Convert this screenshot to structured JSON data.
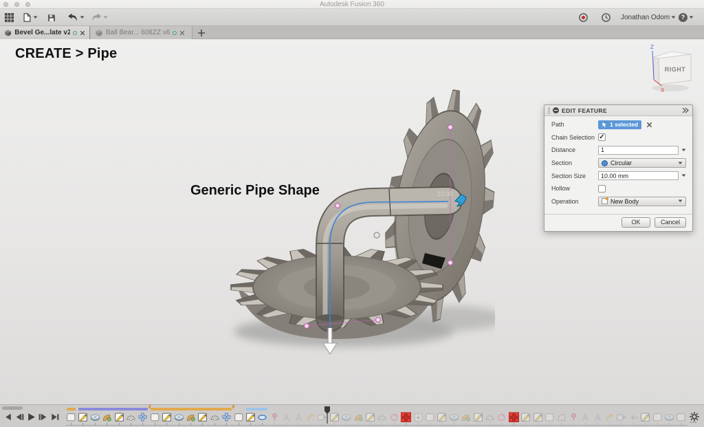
{
  "window": {
    "title": "Autodesk Fusion 360"
  },
  "toolbar": {
    "user_name": "Jonathan Odom",
    "help_glyph": "?"
  },
  "tabs": {
    "items": [
      {
        "label": "Bevel Ge...late v2*"
      },
      {
        "label": "Ball Bear... 608ZZ v6"
      }
    ]
  },
  "canvas": {
    "command_hint": "CREATE > Pipe",
    "annotation": "Generic Pipe Shape",
    "dimension_label": "10.00",
    "viewcube": {
      "face": "RIGHT",
      "axis_z": "Z",
      "axis_x": "X"
    }
  },
  "dialog": {
    "title": "EDIT FEATURE",
    "rows": [
      {
        "label": "Path",
        "value": "1 selected"
      },
      {
        "label": "Chain Selection",
        "checked": true
      },
      {
        "label": "Distance",
        "value": "1"
      },
      {
        "label": "Section",
        "value": "Circular"
      },
      {
        "label": "Section Size",
        "value": "10.00 mm"
      },
      {
        "label": "Hollow",
        "checked": false
      },
      {
        "label": "Operation",
        "value": "New Body"
      }
    ],
    "ok_label": "OK",
    "cancel_label": "Cancel"
  },
  "timeline": {
    "playhead_index": 22,
    "more_indicator": "...",
    "hatch_glyph": "///",
    "groups": [
      {
        "color": "#e3a94e",
        "start": 0,
        "count": 1,
        "hatch": false
      },
      {
        "color": "#8a8ada",
        "start": 1,
        "count": 6,
        "hatch": true
      },
      {
        "color": "#e3a94e",
        "start": 7,
        "count": 7,
        "hatch": true
      },
      {
        "color": "#9cc4ea",
        "start": 15,
        "count": 2,
        "hatch": false
      }
    ],
    "items": [
      {
        "type": "box",
        "state": "normal"
      },
      {
        "type": "sketch",
        "state": "normal"
      },
      {
        "type": "revolve",
        "state": "normal"
      },
      {
        "type": "sweep",
        "state": "normal"
      },
      {
        "type": "sketch",
        "state": "normal"
      },
      {
        "type": "dome",
        "state": "normal"
      },
      {
        "type": "pattern",
        "state": "normal"
      },
      {
        "type": "box",
        "state": "normal"
      },
      {
        "type": "sketch",
        "state": "normal"
      },
      {
        "type": "revolve",
        "state": "normal"
      },
      {
        "type": "sweep",
        "state": "normal"
      },
      {
        "type": "sketch",
        "state": "normal"
      },
      {
        "type": "dome",
        "state": "normal"
      },
      {
        "type": "pattern",
        "state": "normal"
      },
      {
        "type": "box",
        "state": "normal"
      },
      {
        "type": "sketch",
        "state": "normal"
      },
      {
        "type": "link",
        "state": "normal"
      },
      {
        "type": "pin",
        "state": "faded"
      },
      {
        "type": "jointA",
        "state": "faded"
      },
      {
        "type": "jointA",
        "state": "faded"
      },
      {
        "type": "thread",
        "state": "faded"
      },
      {
        "type": "export",
        "state": "faded"
      },
      {
        "type": "sketch",
        "state": "faded"
      },
      {
        "type": "revolve",
        "state": "faded"
      },
      {
        "type": "sweep",
        "state": "faded"
      },
      {
        "type": "sketch",
        "state": "faded"
      },
      {
        "type": "dome",
        "state": "faded"
      },
      {
        "type": "coil",
        "state": "faded"
      },
      {
        "type": "pattern",
        "state": "error"
      },
      {
        "type": "hole",
        "state": "faded"
      },
      {
        "type": "box",
        "state": "faded"
      },
      {
        "type": "sketch",
        "state": "faded"
      },
      {
        "type": "revolve",
        "state": "faded"
      },
      {
        "type": "sweep",
        "state": "faded"
      },
      {
        "type": "sketch",
        "state": "faded"
      },
      {
        "type": "dome",
        "state": "faded"
      },
      {
        "type": "coil",
        "state": "faded"
      },
      {
        "type": "pattern",
        "state": "error"
      },
      {
        "type": "sketch",
        "state": "faded"
      },
      {
        "type": "sketch",
        "state": "faded"
      },
      {
        "type": "box",
        "state": "faded"
      },
      {
        "type": "loft",
        "state": "faded"
      },
      {
        "type": "pin",
        "state": "faded"
      },
      {
        "type": "jointA",
        "state": "faded"
      },
      {
        "type": "jointA",
        "state": "faded"
      },
      {
        "type": "thread",
        "state": "faded"
      },
      {
        "type": "export",
        "state": "faded"
      },
      {
        "type": "leftArrow",
        "state": "faded"
      },
      {
        "type": "sketch",
        "state": "faded"
      },
      {
        "type": "box",
        "state": "faded"
      },
      {
        "type": "revolve",
        "state": "faded"
      },
      {
        "type": "box",
        "state": "faded"
      }
    ]
  },
  "colors": {
    "selection_blue": "#5b97d7",
    "error_red": "#ee3f35",
    "path_blue": "#3f83d6",
    "group_orange": "#e3a94e",
    "group_purple": "#8a8ada"
  }
}
